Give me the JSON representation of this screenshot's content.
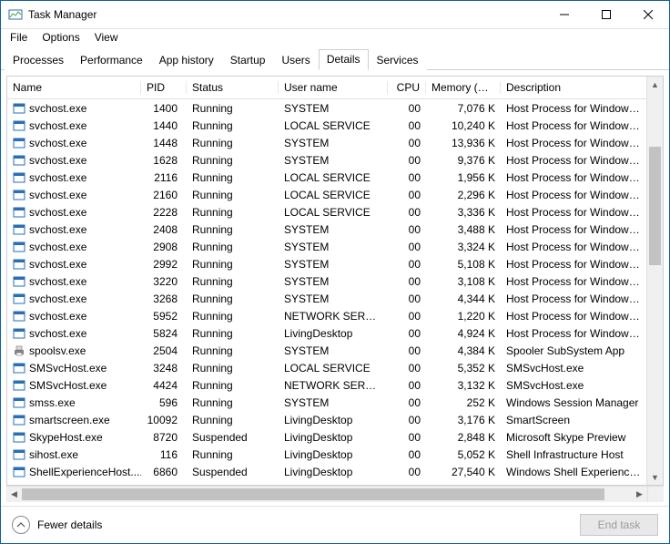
{
  "window": {
    "title": "Task Manager"
  },
  "menu": {
    "file": "File",
    "options": "Options",
    "view": "View"
  },
  "tabs": {
    "processes": "Processes",
    "performance": "Performance",
    "app_history": "App history",
    "startup": "Startup",
    "users": "Users",
    "details": "Details",
    "services": "Services",
    "active": "details"
  },
  "columns": {
    "name": "Name",
    "pid": "PID",
    "status": "Status",
    "user": "User name",
    "cpu": "CPU",
    "mem": "Memory (pri...",
    "desc": "Description"
  },
  "footer": {
    "fewer": "Fewer details",
    "end_task": "End task"
  },
  "processes": [
    {
      "icon": "app",
      "name": "svchost.exe",
      "pid": "1400",
      "status": "Running",
      "user": "SYSTEM",
      "cpu": "00",
      "mem": "7,076 K",
      "desc": "Host Process for Windows Serv"
    },
    {
      "icon": "app",
      "name": "svchost.exe",
      "pid": "1440",
      "status": "Running",
      "user": "LOCAL SERVICE",
      "cpu": "00",
      "mem": "10,240 K",
      "desc": "Host Process for Windows Serv"
    },
    {
      "icon": "app",
      "name": "svchost.exe",
      "pid": "1448",
      "status": "Running",
      "user": "SYSTEM",
      "cpu": "00",
      "mem": "13,936 K",
      "desc": "Host Process for Windows Serv"
    },
    {
      "icon": "app",
      "name": "svchost.exe",
      "pid": "1628",
      "status": "Running",
      "user": "SYSTEM",
      "cpu": "00",
      "mem": "9,376 K",
      "desc": "Host Process for Windows Serv"
    },
    {
      "icon": "app",
      "name": "svchost.exe",
      "pid": "2116",
      "status": "Running",
      "user": "LOCAL SERVICE",
      "cpu": "00",
      "mem": "1,956 K",
      "desc": "Host Process for Windows Serv"
    },
    {
      "icon": "app",
      "name": "svchost.exe",
      "pid": "2160",
      "status": "Running",
      "user": "LOCAL SERVICE",
      "cpu": "00",
      "mem": "2,296 K",
      "desc": "Host Process for Windows Serv"
    },
    {
      "icon": "app",
      "name": "svchost.exe",
      "pid": "2228",
      "status": "Running",
      "user": "LOCAL SERVICE",
      "cpu": "00",
      "mem": "3,336 K",
      "desc": "Host Process for Windows Serv"
    },
    {
      "icon": "app",
      "name": "svchost.exe",
      "pid": "2408",
      "status": "Running",
      "user": "SYSTEM",
      "cpu": "00",
      "mem": "3,488 K",
      "desc": "Host Process for Windows Serv"
    },
    {
      "icon": "app",
      "name": "svchost.exe",
      "pid": "2908",
      "status": "Running",
      "user": "SYSTEM",
      "cpu": "00",
      "mem": "3,324 K",
      "desc": "Host Process for Windows Serv"
    },
    {
      "icon": "app",
      "name": "svchost.exe",
      "pid": "2992",
      "status": "Running",
      "user": "SYSTEM",
      "cpu": "00",
      "mem": "5,108 K",
      "desc": "Host Process for Windows Serv"
    },
    {
      "icon": "app",
      "name": "svchost.exe",
      "pid": "3220",
      "status": "Running",
      "user": "SYSTEM",
      "cpu": "00",
      "mem": "3,108 K",
      "desc": "Host Process for Windows Serv"
    },
    {
      "icon": "app",
      "name": "svchost.exe",
      "pid": "3268",
      "status": "Running",
      "user": "SYSTEM",
      "cpu": "00",
      "mem": "4,344 K",
      "desc": "Host Process for Windows Serv"
    },
    {
      "icon": "app",
      "name": "svchost.exe",
      "pid": "5952",
      "status": "Running",
      "user": "NETWORK SERVICE",
      "cpu": "00",
      "mem": "1,220 K",
      "desc": "Host Process for Windows Serv"
    },
    {
      "icon": "app",
      "name": "svchost.exe",
      "pid": "5824",
      "status": "Running",
      "user": "LivingDesktop",
      "cpu": "00",
      "mem": "4,924 K",
      "desc": "Host Process for Windows Serv"
    },
    {
      "icon": "printer",
      "name": "spoolsv.exe",
      "pid": "2504",
      "status": "Running",
      "user": "SYSTEM",
      "cpu": "00",
      "mem": "4,384 K",
      "desc": "Spooler SubSystem App"
    },
    {
      "icon": "app",
      "name": "SMSvcHost.exe",
      "pid": "3248",
      "status": "Running",
      "user": "LOCAL SERVICE",
      "cpu": "00",
      "mem": "5,352 K",
      "desc": "SMSvcHost.exe"
    },
    {
      "icon": "app",
      "name": "SMSvcHost.exe",
      "pid": "4424",
      "status": "Running",
      "user": "NETWORK SERVICE",
      "cpu": "00",
      "mem": "3,132 K",
      "desc": "SMSvcHost.exe"
    },
    {
      "icon": "app",
      "name": "smss.exe",
      "pid": "596",
      "status": "Running",
      "user": "SYSTEM",
      "cpu": "00",
      "mem": "252 K",
      "desc": "Windows Session Manager"
    },
    {
      "icon": "app",
      "name": "smartscreen.exe",
      "pid": "10092",
      "status": "Running",
      "user": "LivingDesktop",
      "cpu": "00",
      "mem": "3,176 K",
      "desc": "SmartScreen"
    },
    {
      "icon": "app",
      "name": "SkypeHost.exe",
      "pid": "8720",
      "status": "Suspended",
      "user": "LivingDesktop",
      "cpu": "00",
      "mem": "2,848 K",
      "desc": "Microsoft Skype Preview"
    },
    {
      "icon": "app",
      "name": "sihost.exe",
      "pid": "116",
      "status": "Running",
      "user": "LivingDesktop",
      "cpu": "00",
      "mem": "5,052 K",
      "desc": "Shell Infrastructure Host"
    },
    {
      "icon": "app",
      "name": "ShellExperienceHost....",
      "pid": "6860",
      "status": "Suspended",
      "user": "LivingDesktop",
      "cpu": "00",
      "mem": "27,540 K",
      "desc": "Windows Shell Experience Hos"
    }
  ]
}
